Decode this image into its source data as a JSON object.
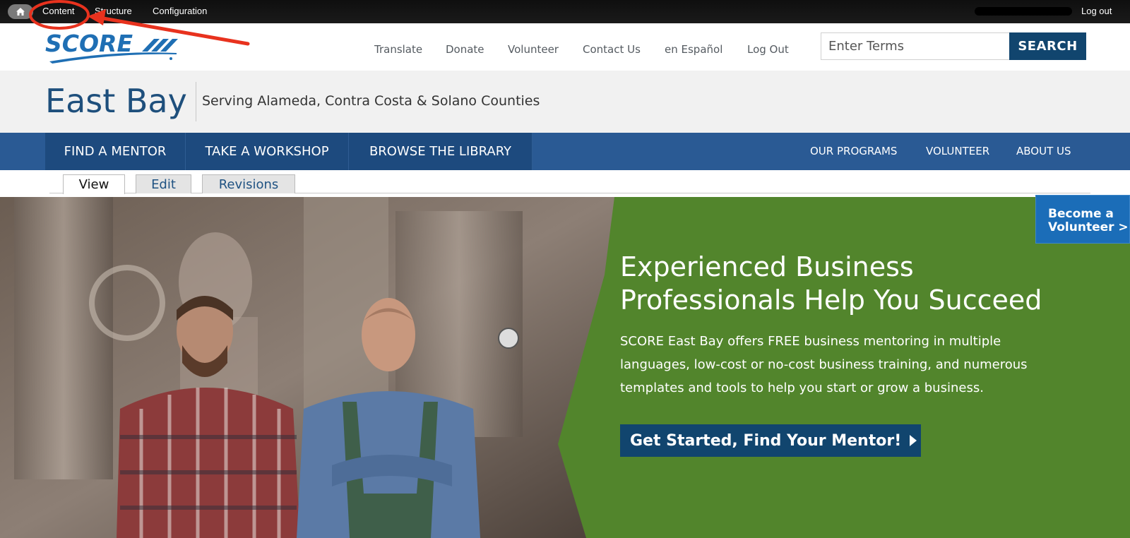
{
  "admin_toolbar": {
    "home_icon": "home-icon",
    "links": [
      "Content",
      "Structure",
      "Configuration"
    ],
    "logout": "Log out"
  },
  "header": {
    "logo_text": "SCORE",
    "utility_links": [
      "Translate",
      "Donate",
      "Volunteer",
      "Contact Us",
      "en Español",
      "Log Out"
    ],
    "search": {
      "placeholder": "Enter Terms",
      "button": "SEARCH"
    }
  },
  "chapter": {
    "title": "East Bay",
    "subtitle": "Serving Alameda, Contra Costa & Solano Counties"
  },
  "main_nav": {
    "primary": [
      "FIND A MENTOR",
      "TAKE A WORKSHOP",
      "BROWSE THE LIBRARY"
    ],
    "secondary": [
      "OUR PROGRAMS",
      "VOLUNTEER",
      "ABOUT US"
    ]
  },
  "tabs": [
    "View",
    "Edit",
    "Revisions"
  ],
  "hero": {
    "heading_line1": "Experienced Business",
    "heading_line2": "Professionals Help You Succeed",
    "body": "SCORE East Bay offers FREE business mentoring in multiple languages, low-cost or no-cost business training, and numerous templates and tools to help you start or grow a business.",
    "cta": "Get Started, Find Your Mentor!",
    "volunteer_line1": "Become a",
    "volunteer_line2": "Volunteer >"
  },
  "colors": {
    "brand_blue": "#1e4f7c",
    "nav_blue": "#2a5a94",
    "hero_green": "#52852c",
    "cta_blue": "#11456e",
    "annotation_red": "#e8321e"
  }
}
